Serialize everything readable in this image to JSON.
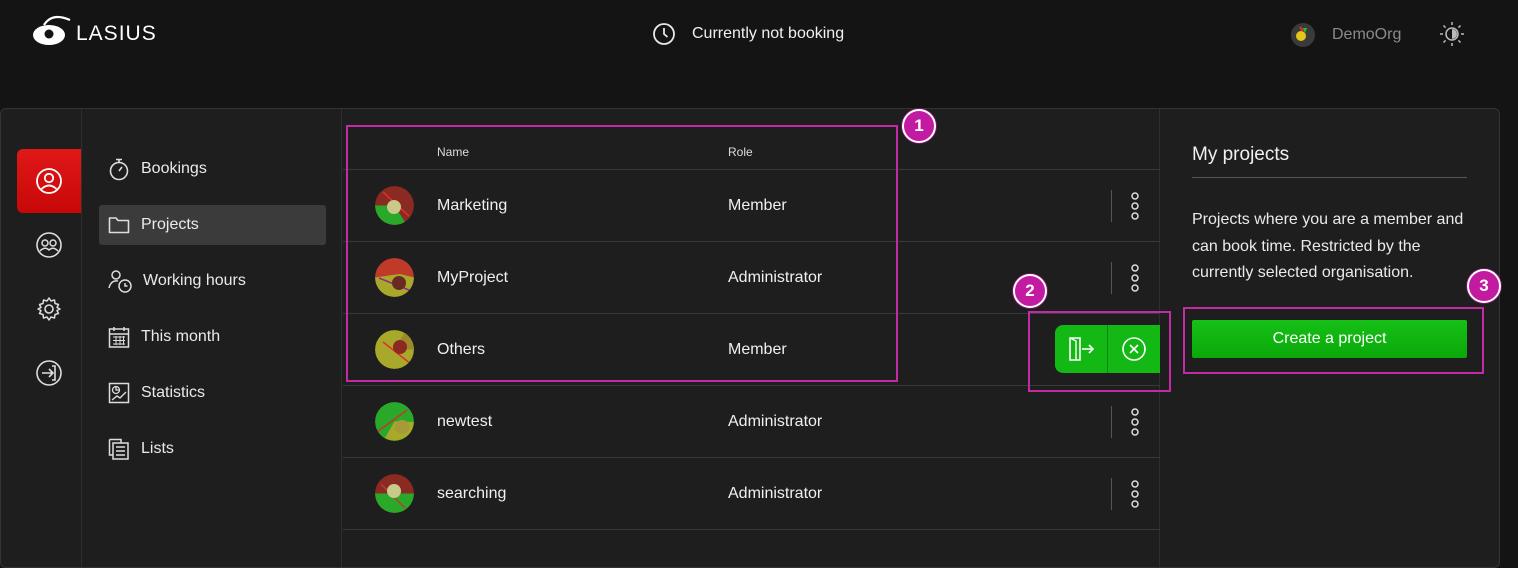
{
  "app": {
    "logo_text": "LASIUS"
  },
  "header": {
    "booking_status": "Currently not booking",
    "org_name": "DemoOrg"
  },
  "nav": {
    "items": [
      {
        "label": "Bookings",
        "icon": "stopwatch-icon"
      },
      {
        "label": "Projects",
        "icon": "folder-icon",
        "active": true
      },
      {
        "label": "Working hours",
        "icon": "user-clock-icon"
      },
      {
        "label": "This month",
        "icon": "calendar-icon"
      },
      {
        "label": "Statistics",
        "icon": "statistics-icon"
      },
      {
        "label": "Lists",
        "icon": "list-icon"
      }
    ]
  },
  "sidebar_icons": [
    "user-icon",
    "team-icon",
    "gear-icon",
    "logout-icon"
  ],
  "projects": {
    "columns": {
      "name": "Name",
      "role": "Role"
    },
    "rows": [
      {
        "name": "Marketing",
        "role": "Member"
      },
      {
        "name": "MyProject",
        "role": "Administrator"
      },
      {
        "name": "Others",
        "role": "Member"
      },
      {
        "name": "newtest",
        "role": "Administrator"
      },
      {
        "name": "searching",
        "role": "Administrator"
      }
    ]
  },
  "panel": {
    "title": "My projects",
    "description": "Projects where you are a member and can book time. Restricted by the currently selected organisation.",
    "create_button": "Create a project"
  },
  "annotations": [
    "1",
    "2",
    "3"
  ],
  "colors": {
    "accent_red": "#e01818",
    "accent_green": "#14b814",
    "highlight_magenta": "#c42aa4"
  }
}
